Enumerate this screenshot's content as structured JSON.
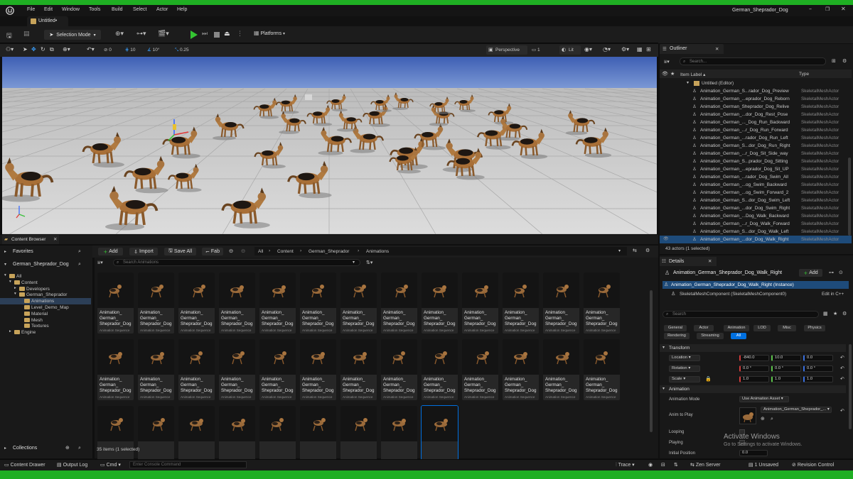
{
  "app": {
    "project_title": "German_Sheprador_Dog",
    "menu": [
      "File",
      "Edit",
      "Window",
      "Tools",
      "Build",
      "Select",
      "Actor",
      "Help"
    ],
    "level_tab": "Untitled•",
    "window_controls": [
      "minimize-icon",
      "maximize-icon",
      "close-icon"
    ]
  },
  "toolbar": {
    "selection_mode": "Selection Mode",
    "platforms": "Platforms"
  },
  "viewport": {
    "snap_angle": "10°",
    "snap_grid": "10",
    "snap_scale": "0.25",
    "speed": "0",
    "perspective": "Perspective",
    "lit": "Lit",
    "layout": "1"
  },
  "outliner": {
    "tab": "Outliner",
    "search_placeholder": "Search...",
    "col_label": "Item Label",
    "col_type": "Type",
    "root": "Untitled (Editor)",
    "items": [
      {
        "label": "Animation_German_S...rador_Dog_Preview",
        "type": "SkeletalMeshActor"
      },
      {
        "label": "Animation_German_...eprador_Dog_Reborn",
        "type": "SkeletalMeshActor"
      },
      {
        "label": "Animation_German_Sheprador_Dog_Relive",
        "type": "SkeletalMeshActor"
      },
      {
        "label": "Animation_German_...dor_Dog_Rest_Pose",
        "type": "SkeletalMeshActor"
      },
      {
        "label": "Animation_German_..._Dog_Run_Backward",
        "type": "SkeletalMeshActor"
      },
      {
        "label": "Animation_German_...r_Dog_Run_Forward",
        "type": "SkeletalMeshActor"
      },
      {
        "label": "Animation_German_...rador_Dog_Run_Left",
        "type": "SkeletalMeshActor"
      },
      {
        "label": "Animation_German_S...dor_Dog_Run_Right",
        "type": "SkeletalMeshActor"
      },
      {
        "label": "Animation_German_...r_Dog_Sit_Side_way",
        "type": "SkeletalMeshActor"
      },
      {
        "label": "Animation_German_S...prador_Dog_Sitting",
        "type": "SkeletalMeshActor"
      },
      {
        "label": "Animation_German_...eprador_Dog_Sit_UP",
        "type": "SkeletalMeshActor"
      },
      {
        "label": "Animation_German_...rador_Dog_Swim_All",
        "type": "SkeletalMeshActor"
      },
      {
        "label": "Animation_German_...og_Swim_Backward",
        "type": "SkeletalMeshActor"
      },
      {
        "label": "Animation_German_...og_Swim_Forward_2",
        "type": "SkeletalMeshActor"
      },
      {
        "label": "Animation_German_S...dor_Dog_Swim_Left",
        "type": "SkeletalMeshActor"
      },
      {
        "label": "Animation_German_...dor_Dog_Swim_Right",
        "type": "SkeletalMeshActor"
      },
      {
        "label": "Animation_German_...Dog_Walk_Backward",
        "type": "SkeletalMeshActor"
      },
      {
        "label": "Animation_German_...r_Dog_Walk_Forward",
        "type": "SkeletalMeshActor"
      },
      {
        "label": "Animation_German_S...dor_Dog_Walk_Left",
        "type": "SkeletalMeshActor"
      },
      {
        "label": "Animation_German_...dor_Dog_Walk_Right",
        "type": "SkeletalMeshActor"
      }
    ],
    "selected_index": 19,
    "status": "43 actors (1 selected)"
  },
  "content_browser": {
    "tab": "Content Browser",
    "add": "Add",
    "import": "Import",
    "save_all": "Save All",
    "fab": "Fab",
    "breadcrumb": [
      "All",
      "Content",
      "German_Sheprador",
      "Animations"
    ],
    "favorites": "Favorites",
    "project": "German_Sheprador_Dog",
    "tree": [
      {
        "label": "All",
        "depth": 0
      },
      {
        "label": "Content",
        "depth": 1
      },
      {
        "label": "Developers",
        "depth": 2
      },
      {
        "label": "German_Sheprador",
        "depth": 2
      },
      {
        "label": "Animations",
        "depth": 3
      },
      {
        "label": "Level_Demo_Map",
        "depth": 3
      },
      {
        "label": "Material",
        "depth": 3
      },
      {
        "label": "Mesh",
        "depth": 3
      },
      {
        "label": "Textures",
        "depth": 3
      },
      {
        "label": "Engine",
        "depth": 1
      }
    ],
    "search_placeholder": "Search Animations",
    "asset_name": "Animation_\nGerman_\nSheprador_Dog",
    "asset_type": "Animation Sequence",
    "asset_count_rows": [
      13,
      13,
      9
    ],
    "collections": "Collections",
    "item_status": "35 items (1 selected)"
  },
  "details": {
    "tab": "Details",
    "actor_name": "Animation_German_Sheprador_Dog_Walk_Right",
    "add": "Add",
    "instance": "Animation_German_Sheprador_Dog_Walk_Right (Instance)",
    "component": "SkeletalMeshComponent (SkeletalMeshComponent0)",
    "edit_cpp": "Edit in C++",
    "search_placeholder": "Search",
    "filters": [
      "General",
      "Actor",
      "Animation",
      "LOD",
      "Misc",
      "Physics",
      "Rendering",
      "Streaming",
      "All"
    ],
    "transform_header": "Transform",
    "location_label": "Location",
    "rotation_label": "Rotation",
    "scale_label": "Scale",
    "location": [
      "-840.0",
      "10.0",
      "0.0"
    ],
    "rotation": [
      "0.0 °",
      "0.0 °",
      "0.0 °"
    ],
    "scale": [
      "1.0",
      "1.0",
      "1.0"
    ],
    "animation_header": "Animation",
    "anim_mode_label": "Animation Mode",
    "anim_mode": "Use Animation Asset",
    "anim_to_play_label": "Anim to Play",
    "anim_to_play": "Animation_German_Sheprador_...",
    "looping_label": "Looping",
    "playing_label": "Playing",
    "initial_position_label": "Initial Position",
    "initial_position": "0.0",
    "watermark_title": "Activate Windows",
    "watermark_sub": "Go to Settings to activate Windows."
  },
  "statusbar": {
    "content_drawer": "Content Drawer",
    "output_log": "Output Log",
    "cmd": "Cmd",
    "console_placeholder": "Enter Console Command",
    "trace": "Trace",
    "derived_data": "",
    "zen_server": "Zen Server",
    "unsaved": "1 Unsaved",
    "revision_control": "Revision Control"
  },
  "colors": {
    "accent_blue": "#0070e0",
    "play_green": "#34c432",
    "selection_row": "#1e4b7a",
    "frame_green": "#1faf23"
  }
}
